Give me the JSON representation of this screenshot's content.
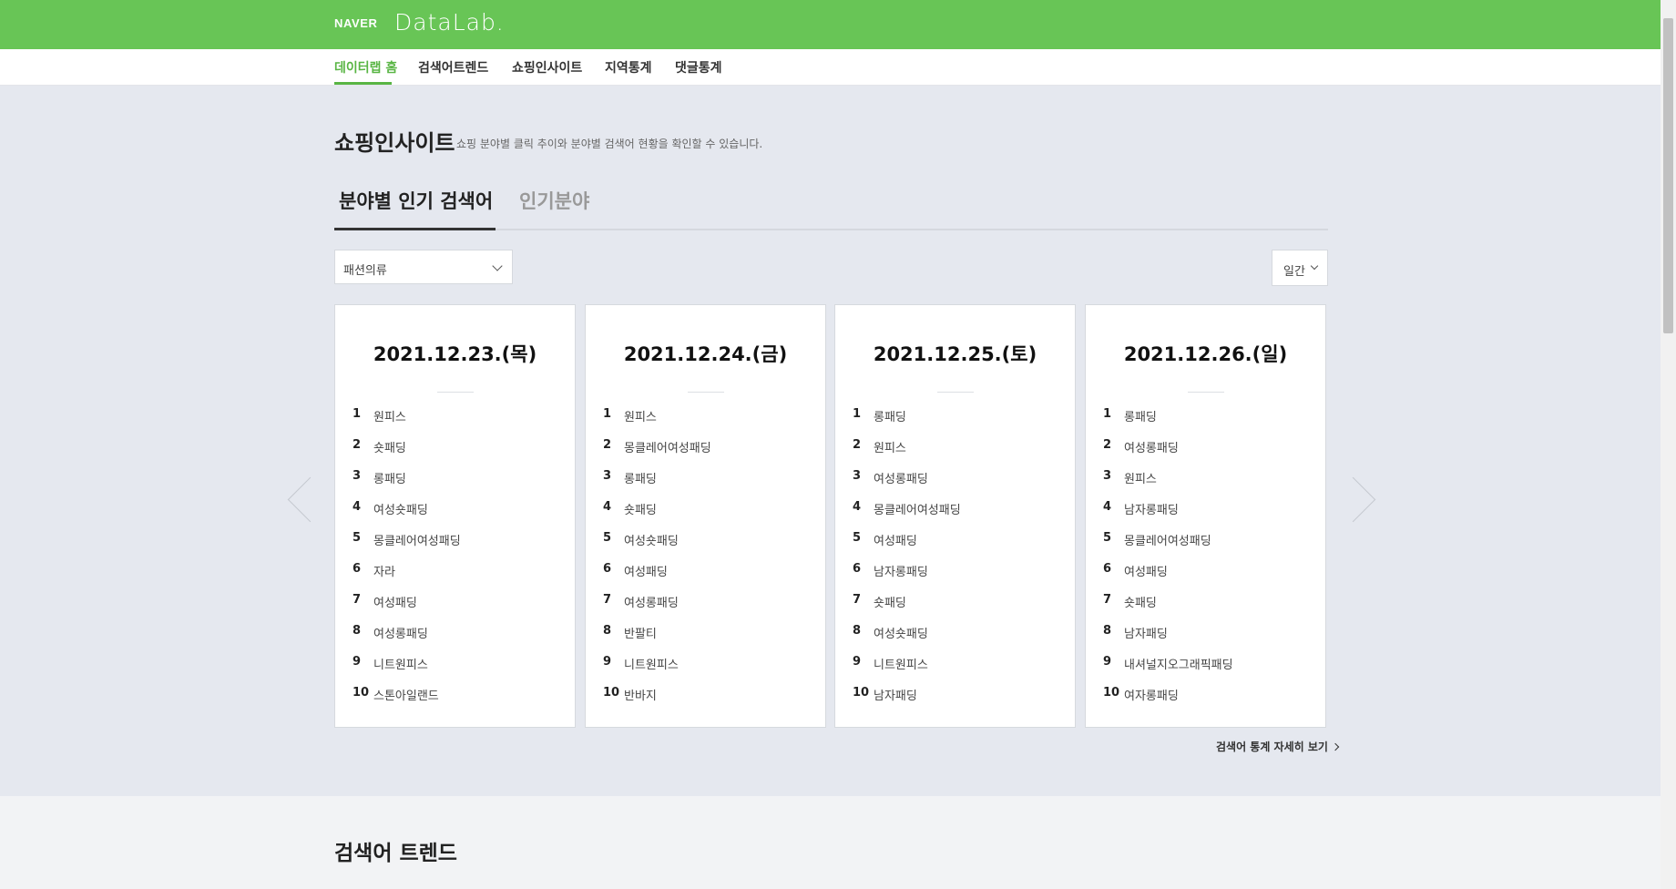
{
  "header": {
    "brand": "NAVER",
    "product": "DataLab."
  },
  "nav": {
    "items": [
      {
        "label": "데이터랩 홈",
        "active": true
      },
      {
        "label": "검색어트렌드",
        "active": false
      },
      {
        "label": "쇼핑인사이트",
        "active": false
      },
      {
        "label": "지역통계",
        "active": false
      },
      {
        "label": "댓글통계",
        "active": false
      }
    ]
  },
  "colors": {
    "brand_green": "#68c556",
    "active_green": "#59b544",
    "section_bg": "#e5e8ef"
  },
  "shopping": {
    "title": "쇼핑인사이트",
    "description": "쇼핑 분야별 클릭 추이와 분야별 검색어 현황을 확인할 수 있습니다.",
    "tabs": [
      {
        "label": "분야별 인기 검색어",
        "active": true
      },
      {
        "label": "인기분야",
        "active": false
      }
    ],
    "category_select": "패션의류",
    "period_select": "일간",
    "cards": [
      {
        "date": "2021.12.23.(목)",
        "items": [
          {
            "rank": "1",
            "keyword": "원피스"
          },
          {
            "rank": "2",
            "keyword": "숏패딩"
          },
          {
            "rank": "3",
            "keyword": "롱패딩"
          },
          {
            "rank": "4",
            "keyword": "여성숏패딩"
          },
          {
            "rank": "5",
            "keyword": "몽클레어여성패딩"
          },
          {
            "rank": "6",
            "keyword": "자라"
          },
          {
            "rank": "7",
            "keyword": "여성패딩"
          },
          {
            "rank": "8",
            "keyword": "여성롱패딩"
          },
          {
            "rank": "9",
            "keyword": "니트원피스"
          },
          {
            "rank": "10",
            "keyword": "스톤아일랜드"
          }
        ]
      },
      {
        "date": "2021.12.24.(금)",
        "items": [
          {
            "rank": "1",
            "keyword": "원피스"
          },
          {
            "rank": "2",
            "keyword": "몽클레어여성패딩"
          },
          {
            "rank": "3",
            "keyword": "롱패딩"
          },
          {
            "rank": "4",
            "keyword": "숏패딩"
          },
          {
            "rank": "5",
            "keyword": "여성숏패딩"
          },
          {
            "rank": "6",
            "keyword": "여성패딩"
          },
          {
            "rank": "7",
            "keyword": "여성롱패딩"
          },
          {
            "rank": "8",
            "keyword": "반팔티"
          },
          {
            "rank": "9",
            "keyword": "니트원피스"
          },
          {
            "rank": "10",
            "keyword": "반바지"
          }
        ]
      },
      {
        "date": "2021.12.25.(토)",
        "items": [
          {
            "rank": "1",
            "keyword": "롱패딩"
          },
          {
            "rank": "2",
            "keyword": "원피스"
          },
          {
            "rank": "3",
            "keyword": "여성롱패딩"
          },
          {
            "rank": "4",
            "keyword": "몽클레어여성패딩"
          },
          {
            "rank": "5",
            "keyword": "여성패딩"
          },
          {
            "rank": "6",
            "keyword": "남자롱패딩"
          },
          {
            "rank": "7",
            "keyword": "숏패딩"
          },
          {
            "rank": "8",
            "keyword": "여성숏패딩"
          },
          {
            "rank": "9",
            "keyword": "니트원피스"
          },
          {
            "rank": "10",
            "keyword": "남자패딩"
          }
        ]
      },
      {
        "date": "2021.12.26.(일)",
        "items": [
          {
            "rank": "1",
            "keyword": "롱패딩"
          },
          {
            "rank": "2",
            "keyword": "여성롱패딩"
          },
          {
            "rank": "3",
            "keyword": "원피스"
          },
          {
            "rank": "4",
            "keyword": "남자롱패딩"
          },
          {
            "rank": "5",
            "keyword": "몽클레어여성패딩"
          },
          {
            "rank": "6",
            "keyword": "여성패딩"
          },
          {
            "rank": "7",
            "keyword": "숏패딩"
          },
          {
            "rank": "8",
            "keyword": "남자패딩"
          },
          {
            "rank": "9",
            "keyword": "내셔널지오그래픽패딩"
          },
          {
            "rank": "10",
            "keyword": "여자롱패딩"
          }
        ]
      }
    ],
    "more_link": "검색어 통계 자세히 보기"
  },
  "trend": {
    "title": "검색어 트렌드"
  }
}
